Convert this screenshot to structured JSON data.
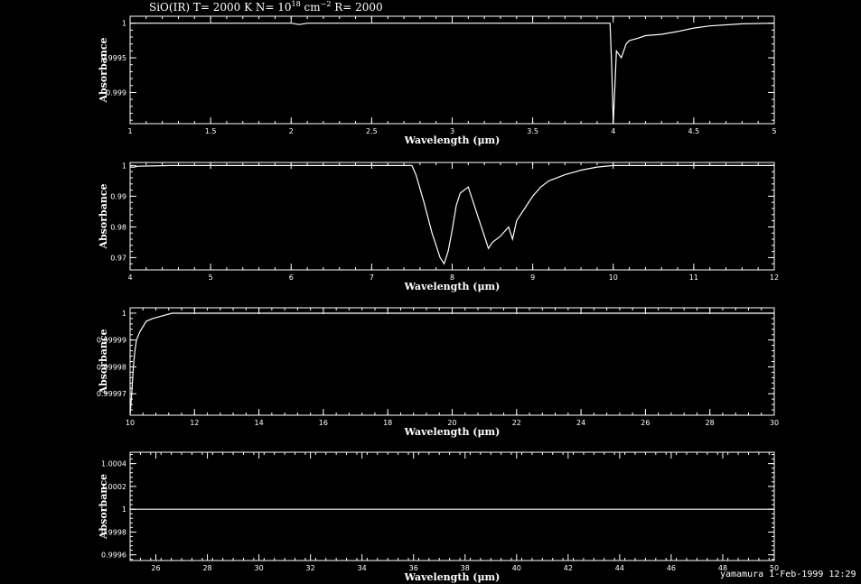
{
  "title": {
    "prefix": "SiO(IR) T= 2000 K N= 10",
    "exp1": "18",
    "mid": " cm",
    "exp2": "−2",
    "suffix": " R= 2000"
  },
  "footer": "yamamura  1-Feb-1999 12:29",
  "colors": {
    "background": "#000000",
    "foreground": "#ffffff"
  },
  "chart_data": [
    {
      "type": "line",
      "xlabel": "Wavelength (μm)",
      "ylabel": "Absorbance",
      "xlim": [
        1,
        5
      ],
      "ylim": [
        0.99855,
        1.0001
      ],
      "xticks": [
        1,
        1.5,
        2,
        2.5,
        3,
        3.5,
        4,
        4.5,
        5
      ],
      "xtick_labels": [
        "1",
        "1.5",
        "2",
        "2.5",
        "3",
        "3.5",
        "4",
        "4.5",
        "5"
      ],
      "yticks": [
        0.999,
        0.9995,
        1
      ],
      "ytick_labels": [
        "0.999",
        "0.9995",
        "1"
      ],
      "series": [
        {
          "x": [
            1,
            2.0,
            2.05,
            2.1,
            3.0,
            3.98,
            3.99,
            4.0,
            4.02,
            4.05,
            4.08,
            4.1,
            4.15,
            4.2,
            4.3,
            4.4,
            4.5,
            4.6,
            4.8,
            5
          ],
          "y": [
            1,
            1,
            0.99998,
            1,
            1,
            1,
            0.9994,
            0.99855,
            0.9996,
            0.9995,
            0.9997,
            0.99975,
            0.99978,
            0.99982,
            0.99984,
            0.99988,
            0.99993,
            0.99996,
            0.99999,
            1
          ]
        }
      ]
    },
    {
      "type": "line",
      "xlabel": "Wavelength (μm)",
      "ylabel": "Absorbance",
      "xlim": [
        4,
        12
      ],
      "ylim": [
        0.966,
        1.001
      ],
      "xticks": [
        4,
        5,
        6,
        7,
        8,
        9,
        10,
        11,
        12
      ],
      "xtick_labels": [
        "4",
        "5",
        "6",
        "7",
        "8",
        "9",
        "10",
        "11",
        "12"
      ],
      "yticks": [
        0.97,
        0.98,
        0.99,
        1
      ],
      "ytick_labels": [
        "0.97",
        "0.98",
        "0.99",
        "1"
      ],
      "series": [
        {
          "x": [
            4,
            4.05,
            4.1,
            4.5,
            7.5,
            7.55,
            7.65,
            7.75,
            7.85,
            7.9,
            7.95,
            8.0,
            8.05,
            8.1,
            8.2,
            8.3,
            8.4,
            8.45,
            8.5,
            8.6,
            8.7,
            8.75,
            8.8,
            8.9,
            9.0,
            9.1,
            9.2,
            9.4,
            9.6,
            9.8,
            10,
            12
          ],
          "y": [
            0.9995,
            0.9995,
            0.9998,
            1,
            1,
            0.997,
            0.988,
            0.978,
            0.97,
            0.968,
            0.972,
            0.979,
            0.987,
            0.991,
            0.993,
            0.985,
            0.977,
            0.973,
            0.975,
            0.977,
            0.98,
            0.976,
            0.982,
            0.986,
            0.99,
            0.993,
            0.995,
            0.997,
            0.9985,
            0.9995,
            1,
            1
          ]
        }
      ]
    },
    {
      "type": "line",
      "xlabel": "Wavelength (μm)",
      "ylabel": "Absorbance",
      "xlim": [
        10,
        30
      ],
      "ylim": [
        0.999962,
        1.000002
      ],
      "xticks": [
        10,
        12,
        14,
        16,
        18,
        20,
        22,
        24,
        26,
        28,
        30
      ],
      "xtick_labels": [
        "10",
        "12",
        "14",
        "16",
        "18",
        "20",
        "22",
        "24",
        "26",
        "28",
        "30"
      ],
      "yticks": [
        0.99997,
        0.99998,
        0.99999,
        1
      ],
      "ytick_labels": [
        "0.99997",
        "0.99998",
        "0.99999",
        "1"
      ],
      "series": [
        {
          "x": [
            10,
            10.05,
            10.1,
            10.15,
            10.2,
            10.3,
            10.4,
            10.5,
            10.7,
            11.0,
            11.3,
            30
          ],
          "y": [
            0.999962,
            0.99997,
            0.99998,
            0.999986,
            0.99999,
            0.999993,
            0.999995,
            0.999997,
            0.999998,
            0.999999,
            1,
            1
          ]
        }
      ]
    },
    {
      "type": "line",
      "xlabel": "Wavelength (μm)",
      "ylabel": "Absorbance",
      "xlim": [
        25,
        50
      ],
      "ylim": [
        0.99955,
        1.0005
      ],
      "xticks": [
        26,
        28,
        30,
        32,
        34,
        36,
        38,
        40,
        42,
        44,
        46,
        48,
        50
      ],
      "xtick_labels": [
        "26",
        "28",
        "30",
        "32",
        "34",
        "36",
        "38",
        "40",
        "42",
        "44",
        "46",
        "48",
        "50"
      ],
      "yticks": [
        0.9996,
        0.9998,
        1,
        1.0002,
        1.0004
      ],
      "ytick_labels": [
        "0.9996",
        "0.9998",
        "1",
        "1.0002",
        "1.0004"
      ],
      "series": [
        {
          "x": [
            25,
            50
          ],
          "y": [
            1,
            1
          ]
        }
      ]
    }
  ]
}
